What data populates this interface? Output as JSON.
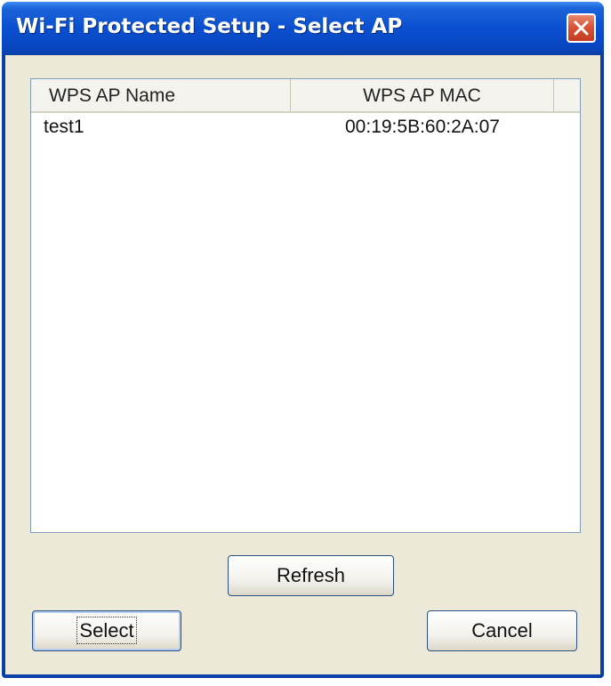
{
  "window": {
    "title": "Wi-Fi Protected Setup - Select AP"
  },
  "list": {
    "columns": [
      "WPS AP Name",
      "WPS AP MAC"
    ],
    "rows": [
      {
        "name": "test1",
        "mac": "00:19:5B:60:2A:07"
      }
    ]
  },
  "buttons": {
    "refresh": "Refresh",
    "select": "Select",
    "cancel": "Cancel"
  },
  "icons": {
    "close": "close-icon"
  },
  "colors": {
    "titlebar": "#0a4fd0",
    "client": "#ece9d8",
    "close": "#d9553a"
  }
}
